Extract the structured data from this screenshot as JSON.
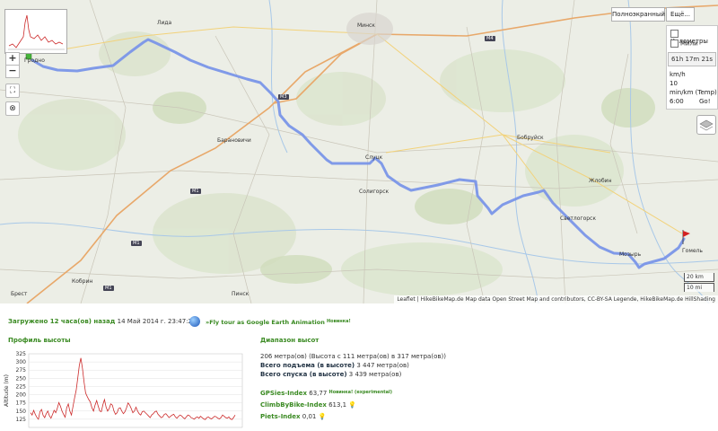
{
  "map": {
    "fullscreen_label": "Полноэкранный",
    "more_label": "Ещё...",
    "zoom_in": "+",
    "zoom_out": "−",
    "units": {
      "km_label": "Километры",
      "mi_label": "Мили",
      "km_checked": false,
      "mi_checked": false
    },
    "time_label": "61h 17m 21s",
    "speed_unit": "km/h",
    "speed_value": "10",
    "pace_label": "min/km (Temp)",
    "pace_value": "6:00",
    "go_label": "Go!",
    "scale": [
      "20 km",
      "10 mi"
    ],
    "attribution": "Leaflet | HikeBikeMap.de Map data Open Street Map and contributors, CC-BY-SA Legende, HikeBikeMap.de HillShading",
    "cities": [
      {
        "name": "Гродно"
      },
      {
        "name": "Лида"
      },
      {
        "name": "Минск"
      },
      {
        "name": "Барановичи"
      },
      {
        "name": "Слуцк"
      },
      {
        "name": "Солигорск"
      },
      {
        "name": "Бобруйск"
      },
      {
        "name": "Жлобин"
      },
      {
        "name": "Светлогорск"
      },
      {
        "name": "Гомель"
      },
      {
        "name": "Кобрин"
      },
      {
        "name": "Брест"
      },
      {
        "name": "Пинск"
      },
      {
        "name": "Мозырь"
      }
    ],
    "roads": [
      {
        "name": "M1"
      },
      {
        "name": "M3"
      },
      {
        "name": "M4"
      },
      {
        "name": "M1"
      },
      {
        "name": "M1"
      }
    ],
    "route_color": "#7a95e8"
  },
  "info": {
    "loaded_label": "Загружено 12 часа(ов) назад",
    "loaded_date": "14 Май 2014 г. 23:47:25",
    "fly_link": "»Fly tour as Google Earth Animation",
    "fly_new": "Новинка!",
    "profile_title": "Профиль высоты",
    "range_title": "Диапазон высот",
    "range_line": "206 метра(ов) (Высота с 111 метра(ов) в 317 метра(ов))",
    "ascent_label": "Всего подъема (в высоте)",
    "ascent_value": "3 447 метра(ов)",
    "descent_label": "Всего спуска (в высоте)",
    "descent_value": "3 439 метра(ов)",
    "gpsies_label": "GPSies-Index",
    "gpsies_value": "63,77",
    "gpsies_new": "Новинка! (experimental)",
    "climb_label": "ClimbByBike-Index",
    "climb_value": "613,1",
    "piets_label": "Piets-Index",
    "piets_value": "0,01"
  },
  "chart_data": {
    "type": "area",
    "title": "",
    "xlabel": "",
    "ylabel": "Altitude (m)",
    "ylim": [
      100,
      325
    ],
    "yticks": [
      125,
      150,
      175,
      200,
      225,
      250,
      275,
      300,
      325
    ],
    "series": [
      {
        "values": [
          145,
          138,
          152,
          140,
          131,
          125,
          148,
          155,
          137,
          130,
          142,
          150,
          136,
          128,
          140,
          152,
          145,
          158,
          176,
          165,
          150,
          140,
          131,
          160,
          172,
          150,
          138,
          165,
          190,
          214,
          250,
          290,
          312,
          280,
          240,
          205,
          195,
          185,
          178,
          160,
          150,
          168,
          182,
          165,
          150,
          148,
          170,
          185,
          162,
          150,
          158,
          172,
          168,
          150,
          140,
          145,
          158,
          160,
          150,
          142,
          148,
          160,
          175,
          168,
          158,
          145,
          150,
          162,
          150,
          142,
          138,
          148,
          150,
          145,
          140,
          135,
          130,
          138,
          142,
          148,
          150,
          140,
          135,
          130,
          132,
          140,
          142,
          136,
          130,
          134,
          138,
          140,
          132,
          128,
          134,
          138,
          135,
          130,
          126,
          132,
          138,
          136,
          130,
          128,
          125,
          130,
          132,
          128,
          134,
          130,
          126,
          124,
          130,
          132,
          128,
          126,
          130,
          134,
          132,
          128,
          126,
          130,
          138,
          134,
          130,
          128,
          132,
          126,
          124,
          130,
          138
        ]
      }
    ],
    "color": "#cc2a2a"
  }
}
